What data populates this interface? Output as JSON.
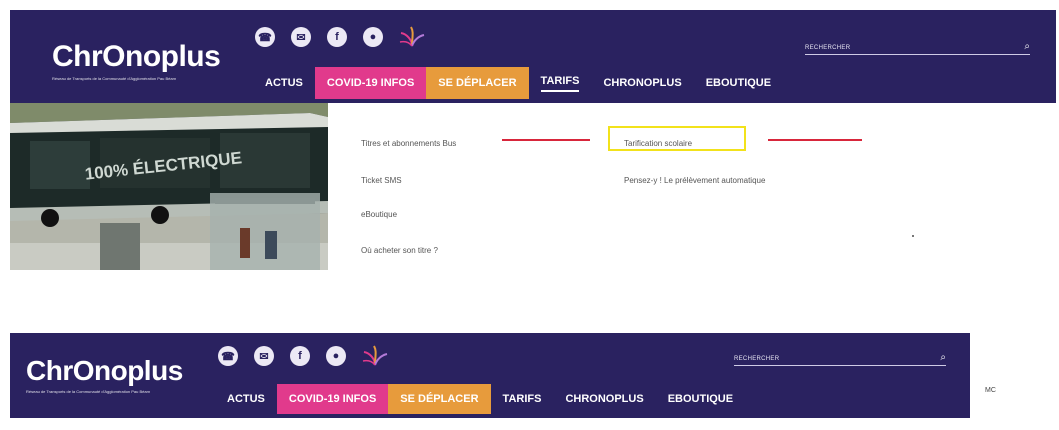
{
  "header": {
    "logo_text": "ChrOnoplus",
    "logo_subtitle": "Réseau de Transports de la Communauté d'Agglomération Pau Béarn",
    "search_placeholder": "RECHERCHER",
    "nav": [
      {
        "label": "ACTUS"
      },
      {
        "label": "COVID-19 INFOS"
      },
      {
        "label": "SE DÉPLACER"
      },
      {
        "label": "TARIFS"
      },
      {
        "label": "CHRONOPLUS"
      },
      {
        "label": "EBOUTIQUE"
      }
    ],
    "social_icons": [
      "phone-icon",
      "mail-icon",
      "facebook-icon",
      "location-icon",
      "flower-logo-icon"
    ]
  },
  "photo": {
    "bus_text": "100% ÉLECTRIQUE"
  },
  "menu": {
    "left_items": [
      "Titres et abonnements Bus",
      "Ticket SMS",
      "eBoutique",
      "Où acheter son titre ?"
    ],
    "right_items": [
      "Tarification scolaire",
      "Pensez-y ! Le prélèvement automatique"
    ]
  },
  "side_text": "MC",
  "colors": {
    "header_bg": "#2a2260",
    "covid": "#e13a8c",
    "deplacer": "#e79b3c",
    "annotation_red": "#d8263b",
    "annotation_yellow": "#f2e21b"
  }
}
